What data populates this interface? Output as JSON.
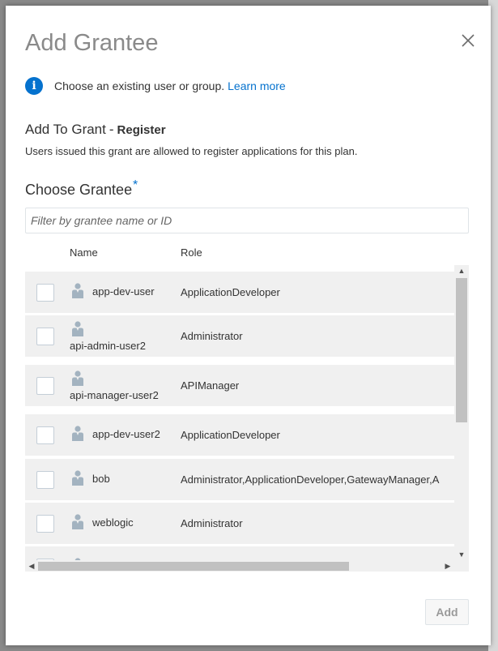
{
  "dialog": {
    "title": "Add Grantee",
    "info_text": "Choose an existing user or group.",
    "learn_more": "Learn more",
    "grant_prefix": "Add To Grant",
    "grant_dash": "-",
    "grant_name": "Register",
    "grant_description": "Users issued this grant are allowed to register applications for this plan.",
    "choose_label": "Choose Grantee",
    "required_marker": "*",
    "filter_placeholder": "Filter by grantee name or ID",
    "columns": {
      "name": "Name",
      "role": "Role"
    },
    "rows": [
      {
        "name": "app-dev-user",
        "role": "ApplicationDeveloper"
      },
      {
        "name": "api-admin-user2",
        "role": "Administrator"
      },
      {
        "name": "api-manager-user2",
        "role": "APIManager"
      },
      {
        "name": "app-dev-user2",
        "role": "ApplicationDeveloper"
      },
      {
        "name": "bob",
        "role": "Administrator,ApplicationDeveloper,GatewayManager,A"
      },
      {
        "name": "weblogic",
        "role": "Administrator"
      },
      {
        "name": "",
        "role": ""
      }
    ],
    "add_button": "Add"
  },
  "icons": {
    "info": "info-icon",
    "close": "close-icon",
    "user": "user-icon"
  },
  "colors": {
    "accent": "#0572ce",
    "title_gray": "#8a8a8a",
    "row_bg": "#f0f0f0"
  }
}
